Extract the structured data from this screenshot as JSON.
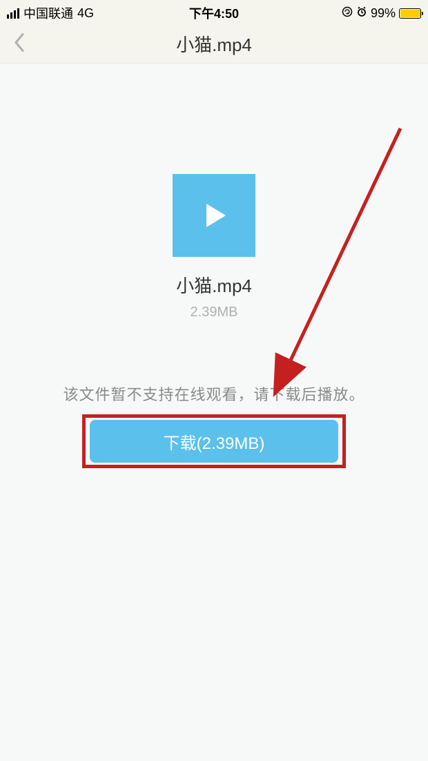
{
  "status_bar": {
    "carrier": "中国联通",
    "network": "4G",
    "time": "下午4:50",
    "battery_percent": "99%"
  },
  "nav": {
    "title": "小猫.mp4"
  },
  "file": {
    "name": "小猫.mp4",
    "size": "2.39MB"
  },
  "notice": "该文件暂不支持在线观看，请下载后播放。",
  "download_button": "下载(2.39MB)"
}
